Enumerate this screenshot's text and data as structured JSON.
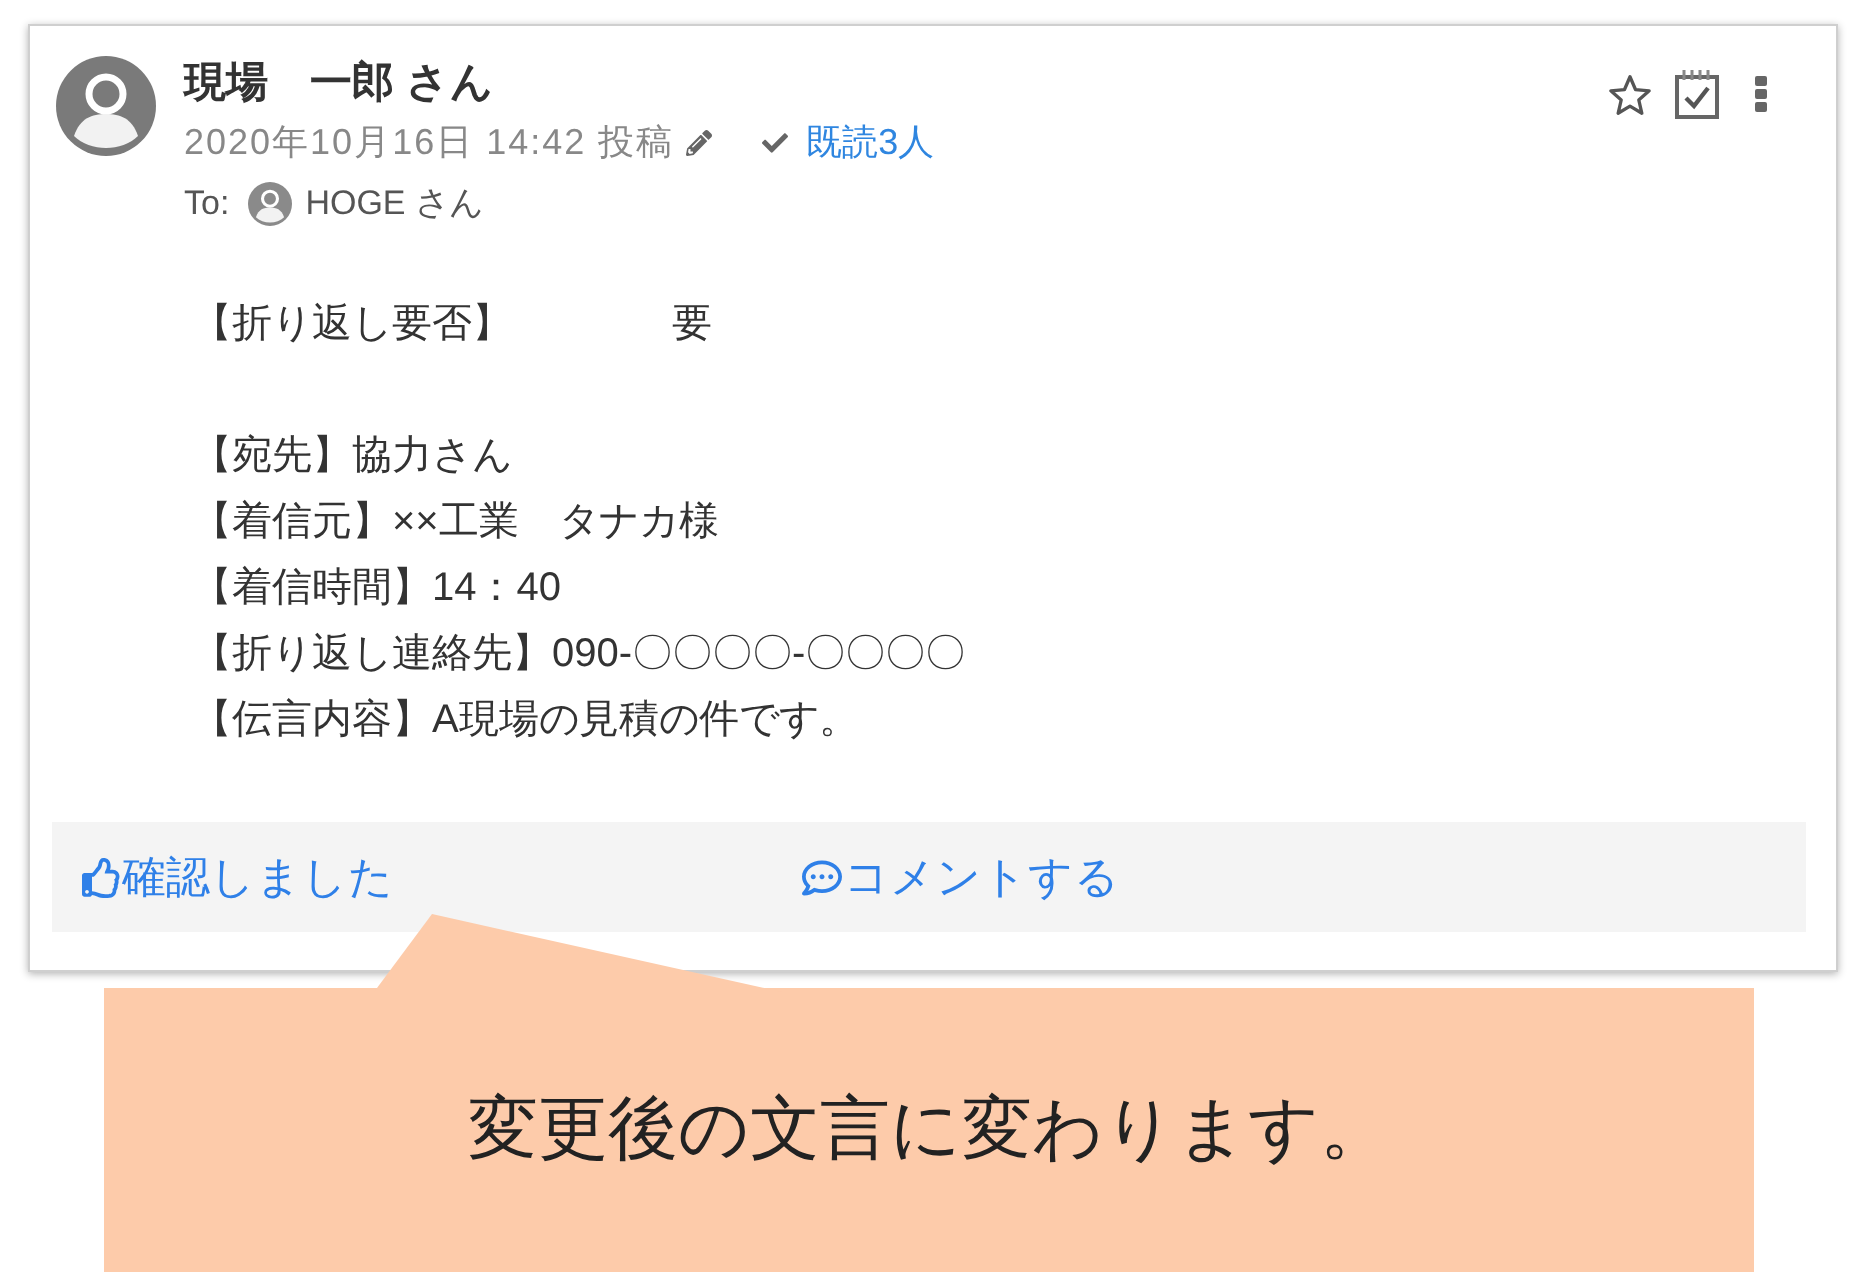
{
  "post": {
    "author": "現場　一郎 さん",
    "posted_at": "2020年10月16日 14:42 投稿",
    "read_status": "既読3人",
    "starred": false,
    "to_label": "To:",
    "recipient": "HOGE さん"
  },
  "body": [
    {
      "lines": [
        "【折り返し要否】　　　　要"
      ]
    },
    {
      "lines": [
        "【宛先】協力さん",
        "【着信元】××工業　タナカ様",
        "【着信時間】14：40",
        "【折り返し連絡先】090-〇〇〇〇-〇〇〇〇",
        "【伝言内容】A現場の見積の件です。"
      ]
    }
  ],
  "actions": [
    {
      "kind": "like",
      "label": "確認しました"
    },
    {
      "kind": "comment",
      "label": "コメントする"
    }
  ],
  "callout": {
    "text": "変更後の文言に変わります。"
  }
}
